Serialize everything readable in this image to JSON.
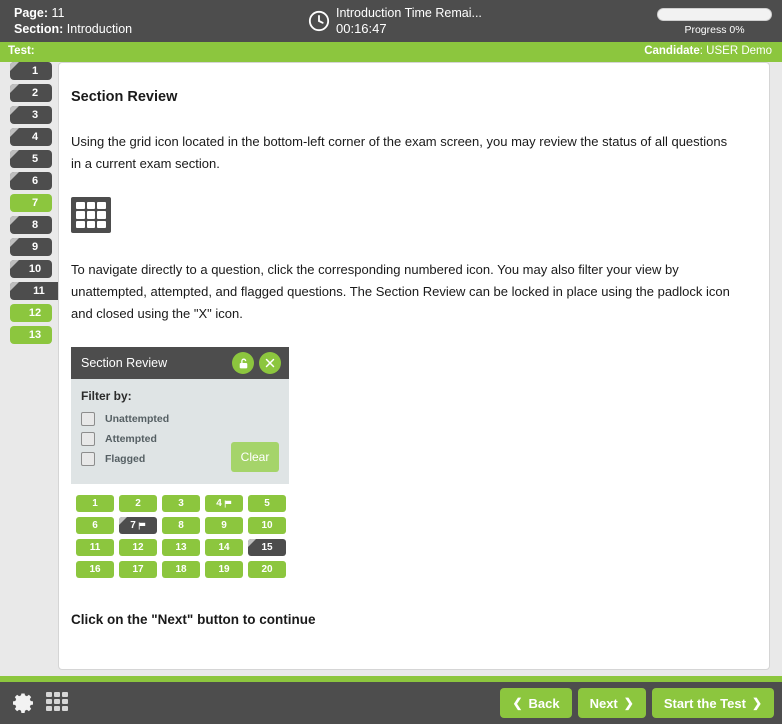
{
  "header": {
    "page_label": "Page:",
    "page_value": "11",
    "section_label": "Section:",
    "section_value": "Introduction",
    "timer_title": "Introduction Time Remai...",
    "timer_value": "00:16:47",
    "progress_label": "Progress 0%",
    "progress_percent": 0,
    "clock_icon": "clock-icon"
  },
  "subbar": {
    "test_label": "Test:",
    "test_value": "",
    "candidate_label": "Candidate",
    "candidate_value": ": USER Demo"
  },
  "sidebar": {
    "items": [
      {
        "label": "1",
        "state": "visited"
      },
      {
        "label": "2",
        "state": "visited"
      },
      {
        "label": "3",
        "state": "visited"
      },
      {
        "label": "4",
        "state": "visited"
      },
      {
        "label": "5",
        "state": "visited"
      },
      {
        "label": "6",
        "state": "visited"
      },
      {
        "label": "7",
        "state": "active"
      },
      {
        "label": "8",
        "state": "visited"
      },
      {
        "label": "9",
        "state": "visited"
      },
      {
        "label": "10",
        "state": "visited"
      },
      {
        "label": "11",
        "state": "current"
      },
      {
        "label": "12",
        "state": "active"
      },
      {
        "label": "13",
        "state": "active"
      }
    ]
  },
  "main": {
    "title": "Section Review",
    "paragraph_1": "Using the grid icon located in the bottom-left corner of the exam screen, you may review the status of all questions in a current exam section.",
    "grid_icon": "grid-icon",
    "paragraph_2": "To navigate directly to a question, click the corresponding numbered icon. You may also filter your view by unattempted, attempted, and flagged questions. The Section Review can be locked in place using the padlock icon and closed using the \"X\" icon.",
    "cta": "Click on the \"Next\" button to continue"
  },
  "section_review": {
    "title": "Section Review",
    "lock_icon": "padlock-open-icon",
    "close_icon": "close-x-icon",
    "filter_label": "Filter by:",
    "filters": [
      {
        "label": "Unattempted",
        "checked": false
      },
      {
        "label": "Attempted",
        "checked": false
      },
      {
        "label": "Flagged",
        "checked": false
      }
    ],
    "clear_label": "Clear",
    "questions": [
      {
        "label": "1",
        "state": "answered",
        "flagged": false
      },
      {
        "label": "2",
        "state": "answered",
        "flagged": false
      },
      {
        "label": "3",
        "state": "answered",
        "flagged": false
      },
      {
        "label": "4",
        "state": "answered",
        "flagged": true
      },
      {
        "label": "5",
        "state": "answered",
        "flagged": false
      },
      {
        "label": "6",
        "state": "answered",
        "flagged": false
      },
      {
        "label": "7",
        "state": "unanswered",
        "flagged": true
      },
      {
        "label": "8",
        "state": "answered",
        "flagged": false
      },
      {
        "label": "9",
        "state": "answered",
        "flagged": false
      },
      {
        "label": "10",
        "state": "answered",
        "flagged": false
      },
      {
        "label": "11",
        "state": "answered",
        "flagged": false
      },
      {
        "label": "12",
        "state": "answered",
        "flagged": false
      },
      {
        "label": "13",
        "state": "answered",
        "flagged": false
      },
      {
        "label": "14",
        "state": "answered",
        "flagged": false
      },
      {
        "label": "15",
        "state": "unanswered",
        "flagged": false
      },
      {
        "label": "16",
        "state": "answered",
        "flagged": false
      },
      {
        "label": "17",
        "state": "answered",
        "flagged": false
      },
      {
        "label": "18",
        "state": "answered",
        "flagged": false
      },
      {
        "label": "19",
        "state": "answered",
        "flagged": false
      },
      {
        "label": "20",
        "state": "answered",
        "flagged": false
      }
    ]
  },
  "footer": {
    "settings_icon": "gear-icon",
    "review_grid_icon": "grid-icon",
    "back_label": "Back",
    "next_label": "Next",
    "start_label": "Start the Test",
    "back_chevron": "❮",
    "next_chevron": "❯"
  },
  "colors": {
    "accent_green": "#8cc63e",
    "dark_gray": "#4d4d4d",
    "panel_gray": "#dfe4e5"
  }
}
